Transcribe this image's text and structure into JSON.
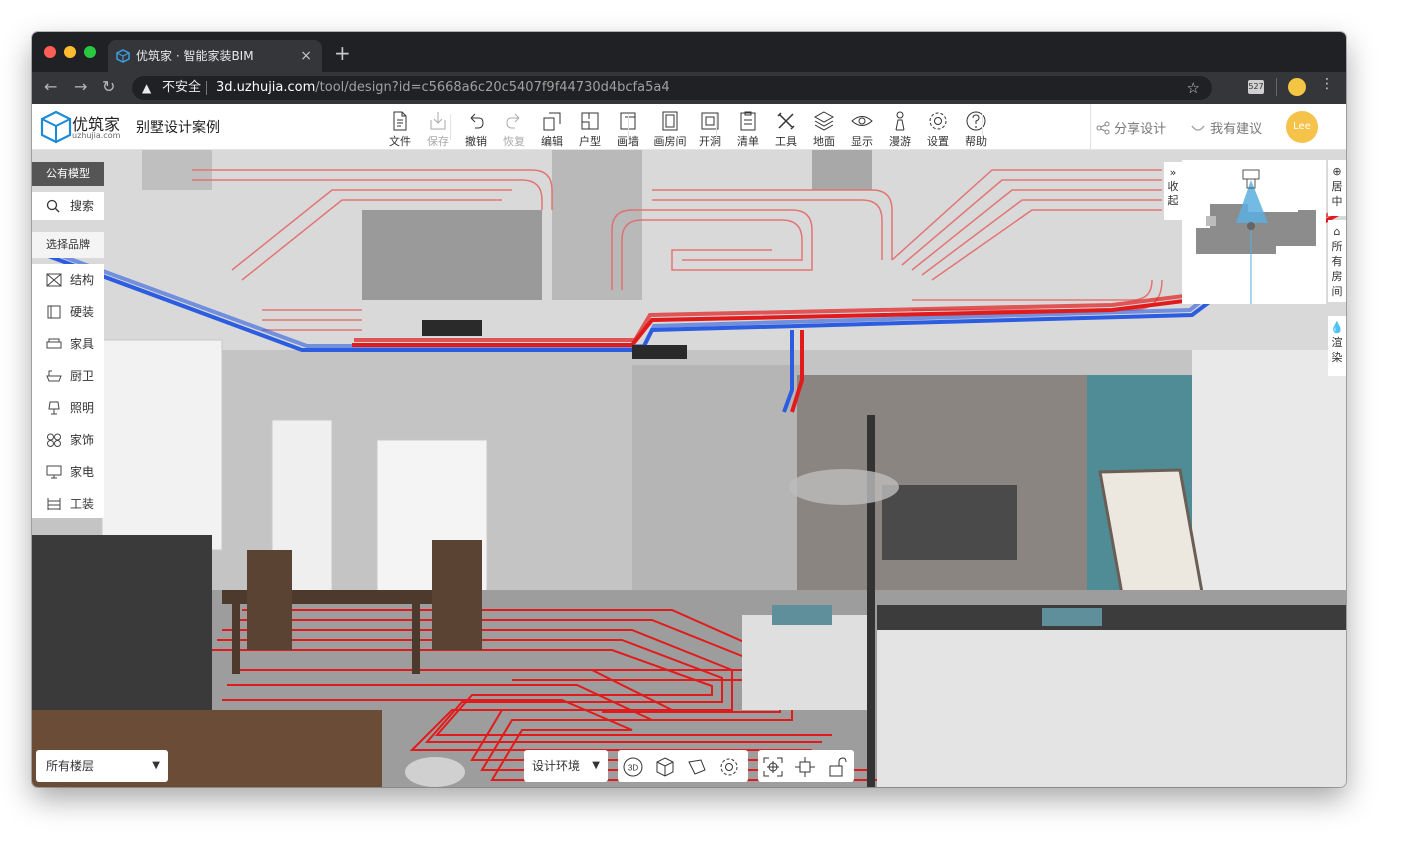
{
  "browser": {
    "tab_title": "优筑家 · 智能家装BIM",
    "tab_close": "×",
    "new_tab": "+",
    "insecure_label": "不安全",
    "url_host": "3d.uzhujia.com",
    "url_path": "/tool/design?id=c5668a6c20c5407f9f44730d4bcfa5a4",
    "ext_badge": "527",
    "colors": {
      "close": "#ff5f57",
      "min": "#febc2e",
      "max": "#28c840"
    }
  },
  "app": {
    "logo_text": "优筑家",
    "logo_sub": "uzhujia.com",
    "project_title": "别墅设计案例",
    "toolbar": [
      {
        "label": "文件",
        "icon": "file-icon"
      },
      {
        "label": "保存",
        "icon": "save-icon"
      },
      {
        "label": "撤销",
        "icon": "undo-icon"
      },
      {
        "label": "恢复",
        "icon": "redo-icon"
      },
      {
        "label": "编辑",
        "icon": "edit-icon"
      },
      {
        "label": "户型",
        "icon": "floorplan-icon"
      },
      {
        "label": "画墙",
        "icon": "wall-icon"
      },
      {
        "label": "画房间",
        "icon": "room-icon"
      },
      {
        "label": "开洞",
        "icon": "opening-icon"
      },
      {
        "label": "清单",
        "icon": "list-icon"
      },
      {
        "label": "工具",
        "icon": "tools-icon"
      },
      {
        "label": "地面",
        "icon": "floor-layers-icon"
      },
      {
        "label": "显示",
        "icon": "eye-icon"
      },
      {
        "label": "漫游",
        "icon": "walk-icon"
      },
      {
        "label": "设置",
        "icon": "gear-icon"
      },
      {
        "label": "帮助",
        "icon": "help-icon"
      }
    ],
    "share_label": "分享设计",
    "suggest_label": "我有建议",
    "avatar_text": "Lee"
  },
  "left_panel": {
    "header": "公有模型",
    "search": "搜索",
    "brand": "选择品牌",
    "categories": [
      "结构",
      "硬装",
      "家具",
      "厨卫",
      "照明",
      "家饰",
      "家电",
      "工装"
    ]
  },
  "right_panel": {
    "collapse": "收起",
    "center": "居中",
    "all_rooms": "所有房间",
    "render": "渲染"
  },
  "bottom": {
    "floor_select": "所有楼层",
    "env_select": "设计环境",
    "view_3d": "3D"
  }
}
